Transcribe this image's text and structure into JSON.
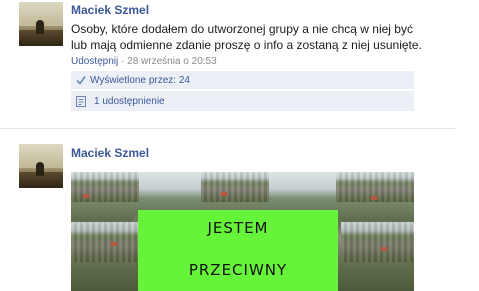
{
  "posts": [
    {
      "author": "Maciek Szmel",
      "text_lines": [
        "Osoby, które dodałem do utworzonej grupy a nie chcą w niej być",
        "lub mają odmienne zdanie proszę o info a zostaną z niej usunięte."
      ],
      "share_link": "Udostępnij",
      "timestamp": " · 28 września o 20:53",
      "views_label": "Wyświetlone przez: 24",
      "views_icon": "checkmark-icon",
      "shares_label": "1 udostępnienie",
      "shares_icon": "share-doc-icon"
    },
    {
      "author": "Maciek Szmel",
      "image_text_lines": [
        "JESTEM",
        "PRZECIWNY"
      ]
    }
  ],
  "colors": {
    "link_blue": "#3b5998",
    "info_box_bg": "#eceff5",
    "sign_green": "#66f43a"
  }
}
